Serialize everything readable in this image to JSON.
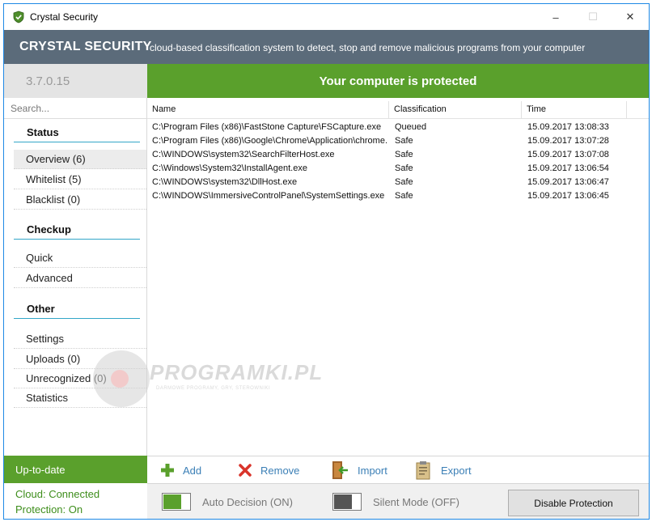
{
  "window": {
    "title": "Crystal Security",
    "controls": {
      "minimize": "–",
      "maximize": "☐",
      "close": "✕"
    }
  },
  "header": {
    "brand": "CRYSTAL SECURITY",
    "tagline": "cloud-based classification system to detect, stop and remove malicious programs from your computer"
  },
  "sidebar": {
    "version": "3.7.0.15",
    "search_placeholder": "Search...",
    "sections": [
      {
        "title": "Status",
        "items": [
          {
            "label": "Overview (6)",
            "active": true
          },
          {
            "label": "Whitelist (5)"
          },
          {
            "label": "Blacklist (0)"
          }
        ]
      },
      {
        "title": "Checkup",
        "items": [
          {
            "label": "Quick"
          },
          {
            "label": "Advanced"
          }
        ]
      },
      {
        "title": "Other",
        "items": [
          {
            "label": "Settings"
          },
          {
            "label": "Uploads (0)"
          },
          {
            "label": "Unrecognized (0)"
          },
          {
            "label": "Statistics"
          }
        ]
      }
    ],
    "update_status": "Up-to-date",
    "cloud_status": "Cloud: Connected",
    "protection_status": "Protection: On"
  },
  "main": {
    "banner": "Your computer is protected",
    "columns": [
      "Name",
      "Classification",
      "Time"
    ],
    "rows": [
      {
        "name": "C:\\Program Files (x86)\\FastStone Capture\\FSCapture.exe",
        "classification": "Queued",
        "time": "15.09.2017 13:08:33"
      },
      {
        "name": "C:\\Program Files (x86)\\Google\\Chrome\\Application\\chrome...",
        "classification": "Safe",
        "time": "15.09.2017 13:07:28"
      },
      {
        "name": "C:\\WINDOWS\\system32\\SearchFilterHost.exe",
        "classification": "Safe",
        "time": "15.09.2017 13:07:08"
      },
      {
        "name": "C:\\Windows\\System32\\InstallAgent.exe",
        "classification": "Safe",
        "time": "15.09.2017 13:06:54"
      },
      {
        "name": "C:\\WINDOWS\\system32\\DllHost.exe",
        "classification": "Safe",
        "time": "15.09.2017 13:06:47"
      },
      {
        "name": "C:\\WINDOWS\\ImmersiveControlPanel\\SystemSettings.exe",
        "classification": "Safe",
        "time": "15.09.2017 13:06:45"
      }
    ],
    "toolbar": {
      "add": "Add",
      "remove": "Remove",
      "import": "Import",
      "export": "Export"
    },
    "bottom": {
      "auto_decision": "Auto Decision (ON)",
      "silent_mode": "Silent Mode (OFF)",
      "disable_button": "Disable Protection"
    }
  },
  "watermark": {
    "text": "PROGRAMKI.PL",
    "subtext": "DARMOWE PROGRAMY, GRY, STEROWNIKI"
  },
  "colors": {
    "accent_green": "#5aa02c",
    "header_slate": "#5b6b7a",
    "section_underline": "#33a6c8",
    "link_blue": "#3b7fb6",
    "window_border": "#1e88e5"
  },
  "icons": {
    "app": "shield-check-icon",
    "add": "plus-icon",
    "remove": "x-icon",
    "import": "door-import-icon",
    "export": "clipboard-export-icon"
  }
}
